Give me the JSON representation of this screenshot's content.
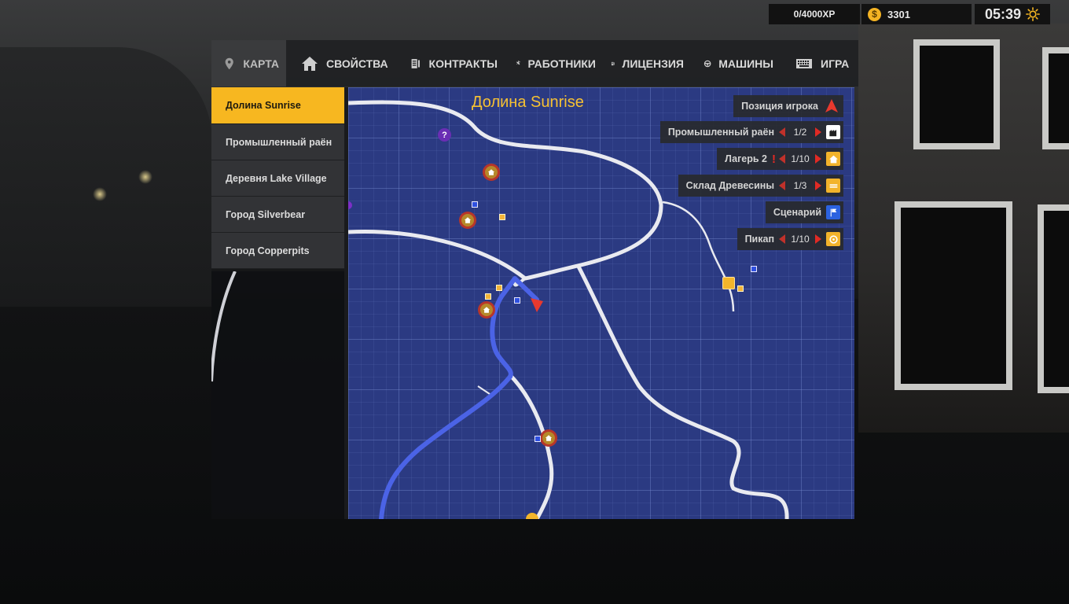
{
  "hud": {
    "xp": "0/4000XP",
    "money": "3301",
    "money_icon": "$",
    "time": "05:39"
  },
  "tabs": [
    {
      "label": "КАРТА",
      "icon": "map-pin-icon",
      "active": true
    },
    {
      "label": "СВОЙСТВА",
      "icon": "house-icon"
    },
    {
      "label": "КОНТРАКТЫ",
      "icon": "contract-icon"
    },
    {
      "label": "РАБОТНИКИ",
      "icon": "tools-icon"
    },
    {
      "label": "ЛИЦЕНЗИЯ",
      "icon": "license-icon"
    },
    {
      "label": "МАШИНЫ",
      "icon": "steering-wheel-icon"
    },
    {
      "label": "ИГРА",
      "icon": "keyboard-icon"
    }
  ],
  "regions": [
    {
      "label": "Долина Sunrise",
      "active": true
    },
    {
      "label": "Промышленный раён"
    },
    {
      "label": "Деревня Lake Village"
    },
    {
      "label": "Город Silverbear"
    },
    {
      "label": "Город Copperpits"
    }
  ],
  "map": {
    "title": "Долина Sunrise",
    "question_mark": "?"
  },
  "legend": [
    {
      "label": "Позиция игрока",
      "icon": "player-arrow-icon",
      "color": "#e8392e"
    },
    {
      "label": "Промышленный раён",
      "count": "1/2",
      "icon": "industry-icon",
      "color": "#ffffff"
    },
    {
      "label": "Лагерь 2",
      "alert": "!",
      "count": "1/10",
      "icon": "house-icon",
      "color": "#f2b32b"
    },
    {
      "label": "Склад Древесины",
      "count": "1/3",
      "icon": "wood-icon",
      "color": "#f2b32b"
    },
    {
      "label": "Сценарий",
      "icon": "scenario-flag-icon",
      "color": "#2b62e0"
    },
    {
      "label": "Пикап",
      "count": "1/10",
      "icon": "pickup-icon",
      "color": "#f2b32b"
    }
  ],
  "colors": {
    "accent": "#f7b720",
    "map_bg": "#2b3a82",
    "route": "#4b63e6",
    "road": "#e9eaf0"
  }
}
